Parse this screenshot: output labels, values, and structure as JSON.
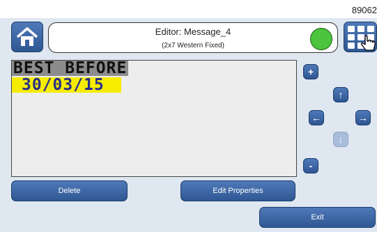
{
  "header": {
    "serial": "89062",
    "title": "Editor: Message_4",
    "subtitle": "(2x7 Western Fixed)",
    "status_color": "#4cc43c"
  },
  "icons": {
    "home": "home-icon",
    "menu": "grid-menu-icon",
    "cursor": "hand-pointer-icon"
  },
  "message": {
    "line1": "BEST BEFORE",
    "line2": "30/03/15",
    "line1_bg": "#8c8c8c",
    "line2_bg": "#f5ec00"
  },
  "controls": {
    "plus": "+",
    "minus": "-",
    "up": "↑",
    "left": "←",
    "right": "→",
    "down": "↓"
  },
  "buttons": {
    "delete": "Delete",
    "edit_properties": "Edit Properties",
    "exit": "Exit"
  },
  "colors": {
    "button_blue": "#3a65a6",
    "panel_bg": "#dfe7f1"
  }
}
